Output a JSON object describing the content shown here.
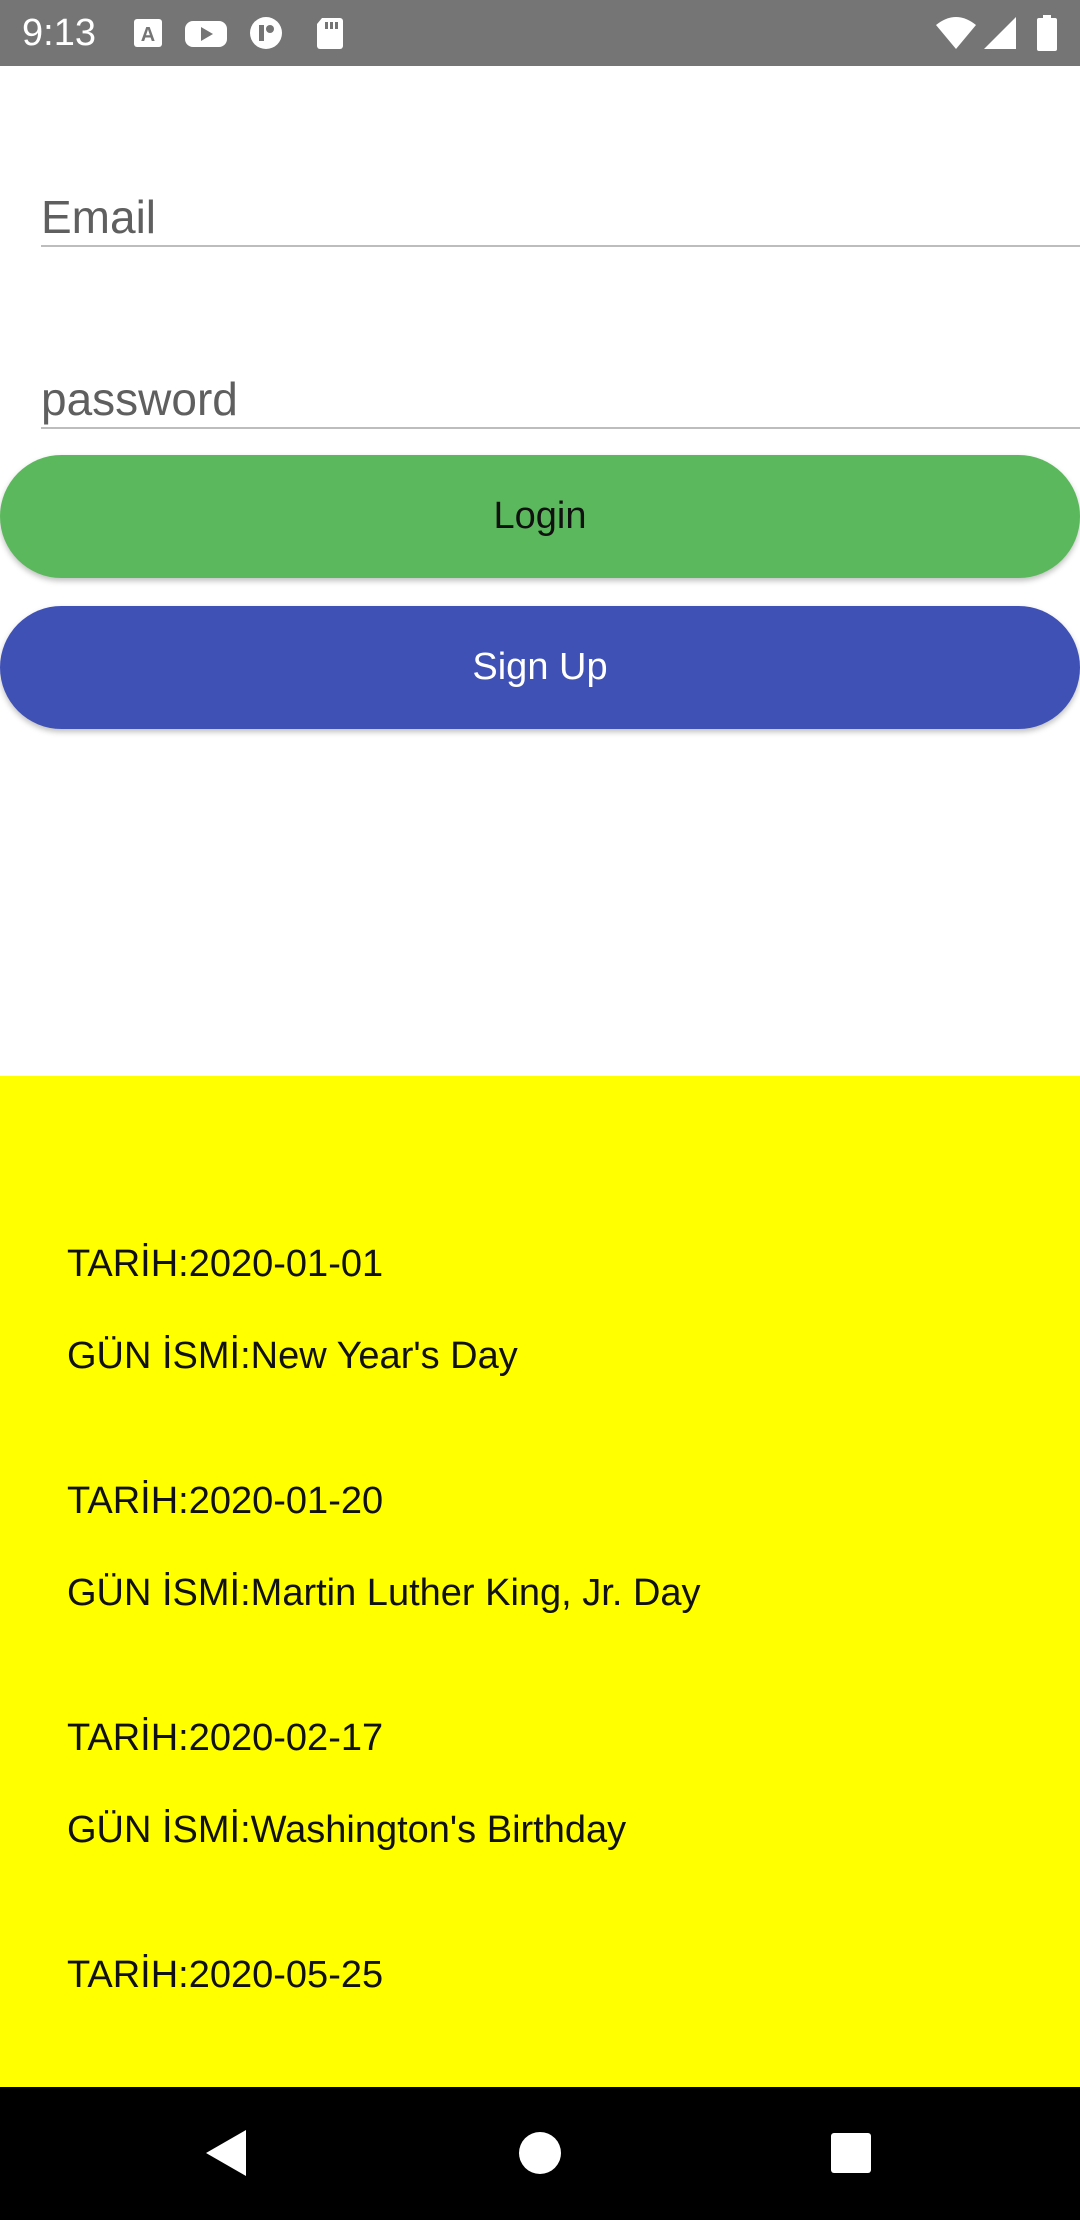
{
  "status_bar": {
    "time": "9:13",
    "icons": [
      "a-icon",
      "youtube-icon",
      "app-icon",
      "sd-card-icon",
      "wifi-icon",
      "signal-icon",
      "battery-icon"
    ]
  },
  "form": {
    "email_placeholder": "Email",
    "password_placeholder": "password",
    "login_label": "Login",
    "signup_label": "Sign Up",
    "login_color": "#5cb85c",
    "signup_color": "#3f51b5"
  },
  "holidays": {
    "background": "#ffff00",
    "items": [
      {
        "date": "TARİH:2020-01-01",
        "name": "GÜN İSMİ:New Year's Day"
      },
      {
        "date": "TARİH:2020-01-20",
        "name": "GÜN İSMİ:Martin Luther King, Jr. Day"
      },
      {
        "date": "TARİH:2020-02-17",
        "name": "GÜN İSMİ:Washington's Birthday"
      },
      {
        "date": "TARİH:2020-05-25",
        "name": ""
      }
    ]
  },
  "nav_bar": {
    "buttons": [
      "back-icon",
      "home-icon",
      "recents-icon"
    ]
  }
}
